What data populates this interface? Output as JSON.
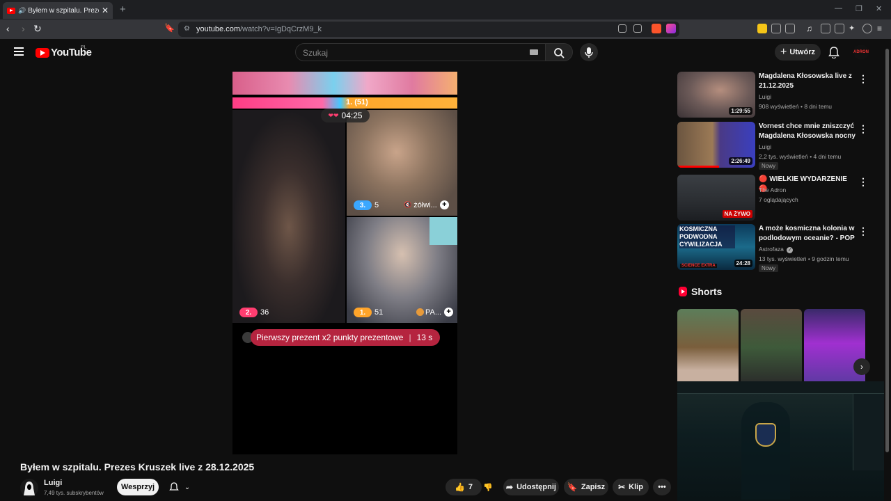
{
  "browser": {
    "tab_title": "Byłem w szpitalu. Prezes Kruszek",
    "url_domain": "youtube.com",
    "url_path": "/watch?v=IgDqCrzM9_k"
  },
  "header": {
    "logo_text": "YouTube",
    "country": "PL",
    "search_placeholder": "Szukaj",
    "create_label": "Utwórz",
    "avatar_text": "ADRON"
  },
  "player": {
    "leader_score": "1. (51)",
    "timer": "04:25",
    "participants": [
      {
        "rank": "2.",
        "score": "36",
        "color": "#ff3d70"
      },
      {
        "rank": "3.",
        "score": "5",
        "nick": "żółwi...",
        "color": "#3aa7ff"
      },
      {
        "rank": "1.",
        "score": "51",
        "nick": "PA...",
        "color": "#ffa42a"
      }
    ],
    "gift_text": "Pierwszy prezent x2 punkty prezentowe",
    "gift_seconds": "13 s"
  },
  "video": {
    "title": "Byłem w szpitalu. Prezes Kruszek live z 28.12.2025",
    "channel": "Luigi",
    "subscribers": "7,49 tys. subskrybentów",
    "support_label": "Wesprzyj",
    "likes": "7",
    "share_label": "Udostępnij",
    "save_label": "Zapisz",
    "clip_label": "Klip"
  },
  "recommendations": [
    {
      "title": "Magdalena Kłosowska live z 21.12.2025",
      "channel": "Luigi",
      "meta": "908 wyświetleń • 8 dni temu",
      "duration": "1:29:55",
      "badge": ""
    },
    {
      "title": "Vornest chce mnie zniszczyć Magdalena Kłosowska nocny ...",
      "channel": "Luigi",
      "meta": "2,2 tys. wyświetleń • 4 dni temu",
      "duration": "2:26:49",
      "badge": "Nowy"
    },
    {
      "title": "🔴 WIELKIE WYDARZENIE 🔴",
      "channel": "The Adron",
      "meta": "7 oglądających",
      "duration": "",
      "live": "NA ŻYWO",
      "badge": ""
    },
    {
      "title": "A może kosmiczna kolonia w podlodowym oceanie? - POP ...",
      "channel": "Astrofaza",
      "meta": "13 tys. wyświetleń • 9 godzin temu",
      "duration": "24:28",
      "badge": "Nowy",
      "thumb_text": "KOSMICZNA PODWODNA CYWILIZACJA",
      "thumb_brand": "SCIENCE EXTRA"
    }
  ],
  "shorts": {
    "heading": "Shorts"
  }
}
